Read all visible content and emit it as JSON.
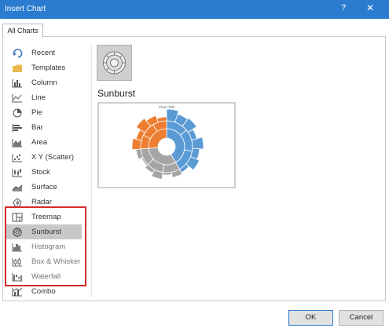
{
  "window": {
    "title": "Insert Chart",
    "help": "?",
    "close": "✕"
  },
  "tabs": [
    {
      "label": "All Charts"
    }
  ],
  "chart_types": [
    {
      "label": "Recent",
      "icon": "recent-icon"
    },
    {
      "label": "Templates",
      "icon": "folder-icon"
    },
    {
      "label": "Column",
      "icon": "column-chart-icon"
    },
    {
      "label": "Line",
      "icon": "line-chart-icon"
    },
    {
      "label": "Pie",
      "icon": "pie-chart-icon"
    },
    {
      "label": "Bar",
      "icon": "bar-chart-icon"
    },
    {
      "label": "Area",
      "icon": "area-chart-icon"
    },
    {
      "label": "X Y (Scatter)",
      "icon": "scatter-chart-icon"
    },
    {
      "label": "Stock",
      "icon": "stock-chart-icon"
    },
    {
      "label": "Surface",
      "icon": "surface-chart-icon"
    },
    {
      "label": "Radar",
      "icon": "radar-chart-icon"
    },
    {
      "label": "Treemap",
      "icon": "treemap-icon"
    },
    {
      "label": "Sunburst",
      "icon": "sunburst-icon",
      "selected": true
    },
    {
      "label": "Histogram",
      "icon": "histogram-icon"
    },
    {
      "label": "Box & Whisker",
      "icon": "box-whisker-icon"
    },
    {
      "label": "Waterfall",
      "icon": "waterfall-icon"
    },
    {
      "label": "Combo",
      "icon": "combo-chart-icon"
    }
  ],
  "selected_chart": {
    "name": "Sunburst",
    "preview_title": "Chart Title"
  },
  "buttons": {
    "ok": "OK",
    "cancel": "Cancel"
  },
  "colors": {
    "titlebar": "#2b7bd0",
    "highlight": "#d42b2b",
    "orange": "#ed7d31",
    "blue": "#5b9bd5",
    "gray": "#a5a5a5"
  }
}
